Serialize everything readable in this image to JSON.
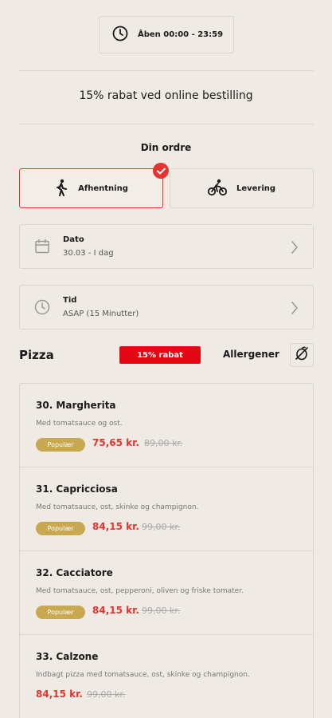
{
  "header": {
    "hours": "Åben 00:00 - 23:59"
  },
  "promo": "15% rabat ved online bestilling",
  "order": {
    "title": "Din ordre",
    "modes": [
      {
        "label": "Afhentning",
        "selected": true
      },
      {
        "label": "Levering",
        "selected": false
      }
    ],
    "date": {
      "label": "Dato",
      "value": "30.03 - I dag"
    },
    "time": {
      "label": "Tid",
      "value": "ASAP (15 Minutter)"
    }
  },
  "category": {
    "name": "Pizza",
    "discount": "15% rabat",
    "allergen_label": "Allergener"
  },
  "items": [
    {
      "name": "30. Margherita",
      "desc": "Med tomatsauce og ost.",
      "badge": "Populær",
      "price": "75,65 kr.",
      "old_price": "89,00 kr."
    },
    {
      "name": "31. Capricciosa",
      "desc": "Med tomatsauce, ost, skinke og champignon.",
      "badge": "Populær",
      "price": "84,15 kr.",
      "old_price": "99,00 kr."
    },
    {
      "name": "32. Cacciatore",
      "desc": "Med tomatsauce, ost, pepperoni, oliven og friske tomater.",
      "badge": "Populær",
      "price": "84,15 kr.",
      "old_price": "99,00 kr."
    },
    {
      "name": "33. Calzone",
      "desc": "Indbagt pizza med tomatsauce, ost, skinke og champignon.",
      "badge": "",
      "price": "84,15 kr.",
      "old_price": "99,00 kr."
    }
  ],
  "colors": {
    "accent": "#e3342f",
    "badge_bg": "#c8a951",
    "background": "#efebe4"
  }
}
